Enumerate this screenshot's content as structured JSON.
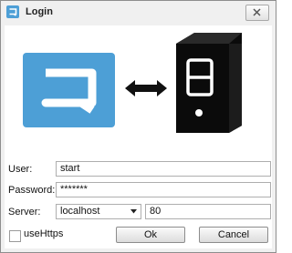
{
  "window": {
    "title": "Login"
  },
  "form": {
    "user_label": "User:",
    "user_value": "start",
    "password_label": "Password:",
    "password_value": "*******",
    "server_label": "Server:",
    "server_value": "localhost",
    "port_value": "80",
    "use_https_label": "useHttps",
    "use_https_checked": false
  },
  "buttons": {
    "ok_label": "Ok",
    "cancel_label": "Cancel"
  },
  "colors": {
    "logo_blue": "#4d9fd6",
    "window_bg": "#f0f0f0",
    "content_bg": "#ffffff"
  },
  "icons": {
    "title": "app-logo-icon",
    "close": "close-icon",
    "app_logo": "app-logo-icon",
    "arrow": "double-arrow-icon",
    "server": "server-icon",
    "dropdown": "chevron-down-icon"
  }
}
